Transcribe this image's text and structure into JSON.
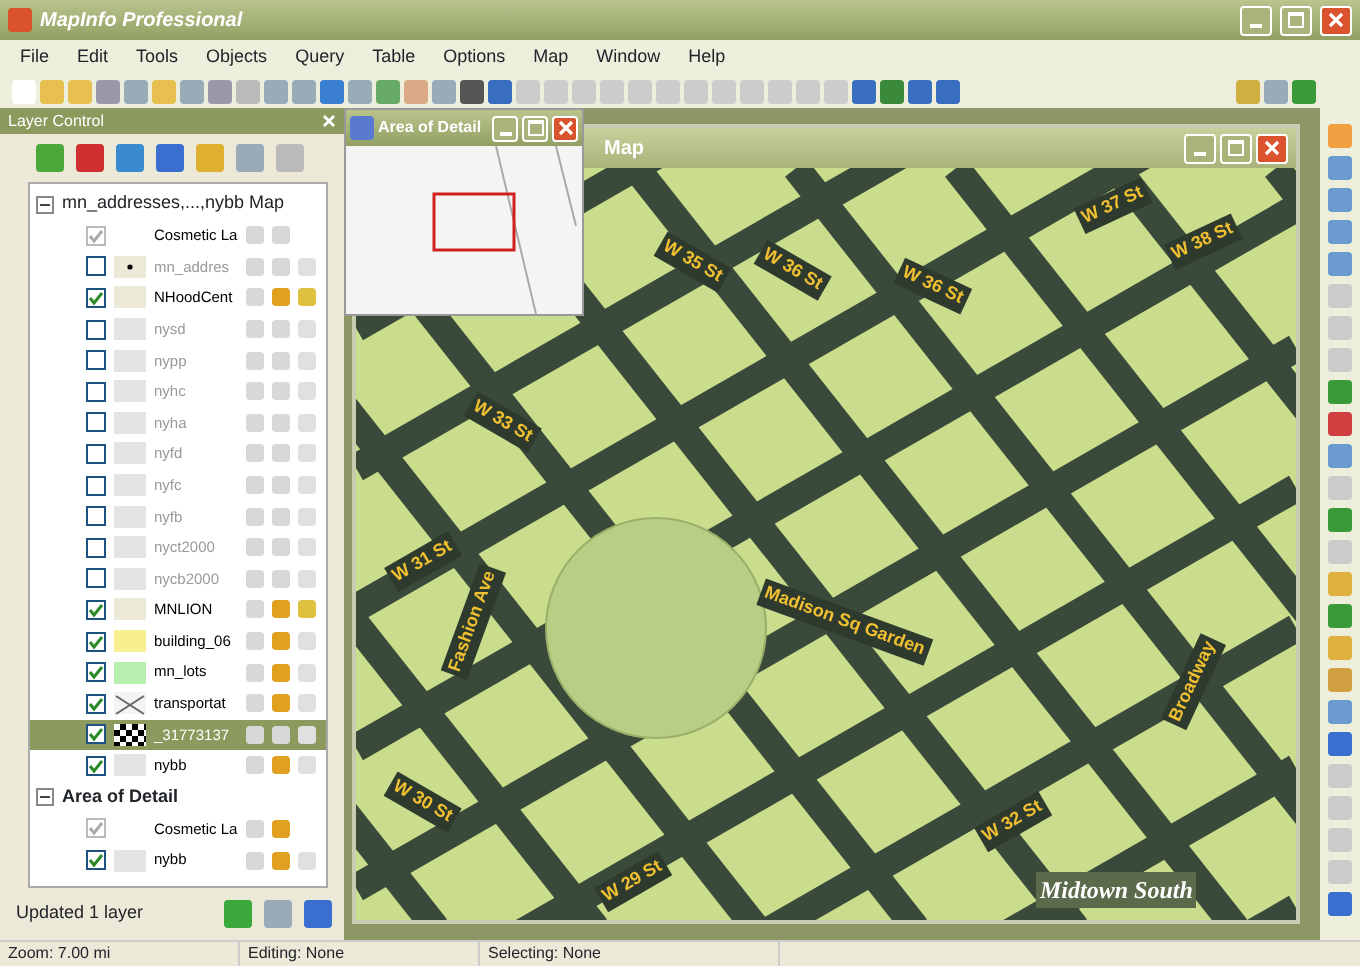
{
  "window": {
    "title": "MapInfo Professional"
  },
  "menu": [
    "File",
    "Edit",
    "Tools",
    "Objects",
    "Query",
    "Table",
    "Options",
    "Map",
    "Window",
    "Help"
  ],
  "layer_control": {
    "title": "Layer Control",
    "groups": [
      {
        "name": "mn_addresses,...,nybb Map",
        "expanded": true,
        "layers": [
          {
            "name": "Cosmetic La",
            "kind": "cosmetic",
            "checked": true,
            "dimmed": false,
            "selected": false,
            "display_on": false
          },
          {
            "name": "mn_addres",
            "kind": "point",
            "checked": false,
            "dimmed": true,
            "selected": false,
            "display_on": false
          },
          {
            "name": "NHoodCent",
            "kind": "plain",
            "checked": true,
            "dimmed": false,
            "selected": false,
            "display_on": true
          },
          {
            "name": "nysd",
            "kind": "region",
            "checked": false,
            "dimmed": true,
            "selected": false,
            "display_on": false
          },
          {
            "name": "nypp",
            "kind": "region",
            "checked": false,
            "dimmed": true,
            "selected": false,
            "display_on": false
          },
          {
            "name": "nyhc",
            "kind": "region",
            "checked": false,
            "dimmed": true,
            "selected": false,
            "display_on": false
          },
          {
            "name": "nyha",
            "kind": "region",
            "checked": false,
            "dimmed": true,
            "selected": false,
            "display_on": false
          },
          {
            "name": "nyfd",
            "kind": "region",
            "checked": false,
            "dimmed": true,
            "selected": false,
            "display_on": false
          },
          {
            "name": "nyfc",
            "kind": "region",
            "checked": false,
            "dimmed": true,
            "selected": false,
            "display_on": false
          },
          {
            "name": "nyfb",
            "kind": "region",
            "checked": false,
            "dimmed": true,
            "selected": false,
            "display_on": false
          },
          {
            "name": "nyct2000",
            "kind": "region",
            "checked": false,
            "dimmed": true,
            "selected": false,
            "display_on": false
          },
          {
            "name": "nycb2000",
            "kind": "region",
            "checked": false,
            "dimmed": true,
            "selected": false,
            "display_on": false
          },
          {
            "name": "MNLION",
            "kind": "plain",
            "checked": true,
            "dimmed": false,
            "selected": false,
            "display_on": true
          },
          {
            "name": "building_06",
            "kind": "yellow",
            "checked": true,
            "dimmed": false,
            "selected": false,
            "display_on": true
          },
          {
            "name": "mn_lots",
            "kind": "green",
            "checked": true,
            "dimmed": false,
            "selected": false,
            "display_on": true
          },
          {
            "name": "transportat",
            "kind": "lines",
            "checked": true,
            "dimmed": false,
            "selected": false,
            "display_on": true
          },
          {
            "name": "_31773137",
            "kind": "raster",
            "checked": true,
            "dimmed": false,
            "selected": true,
            "display_on": false
          },
          {
            "name": "nybb",
            "kind": "region",
            "checked": true,
            "dimmed": false,
            "selected": false,
            "display_on": true
          }
        ]
      },
      {
        "name": "Area of Detail",
        "expanded": true,
        "layers": [
          {
            "name": "Cosmetic La",
            "kind": "cosmetic",
            "checked": true,
            "dimmed": false,
            "selected": false,
            "display_on": true
          },
          {
            "name": "nybb",
            "kind": "region",
            "checked": true,
            "dimmed": false,
            "selected": false,
            "display_on": true
          }
        ]
      }
    ],
    "message": "Updated 1 layer"
  },
  "map_window": {
    "title": "Map",
    "labels": [
      {
        "text": "W 37 St"
      },
      {
        "text": "W 38 St"
      },
      {
        "text": "W 36 St"
      },
      {
        "text": "W 35 St"
      },
      {
        "text": "W 36 St"
      },
      {
        "text": "W 33 St"
      },
      {
        "text": "W 31 St"
      },
      {
        "text": "Fashion Ave"
      },
      {
        "text": "Madison Sq Garden"
      },
      {
        "text": "W 30 St"
      },
      {
        "text": "W 32 St"
      },
      {
        "text": "W 29 St"
      },
      {
        "text": "Broadway"
      },
      {
        "text": "Midtown South"
      }
    ]
  },
  "area_of_detail": {
    "title": "Area of Detail"
  },
  "status_bar": [
    "Zoom: 7.00 mi",
    "Editing: None",
    "Selecting: None"
  ]
}
